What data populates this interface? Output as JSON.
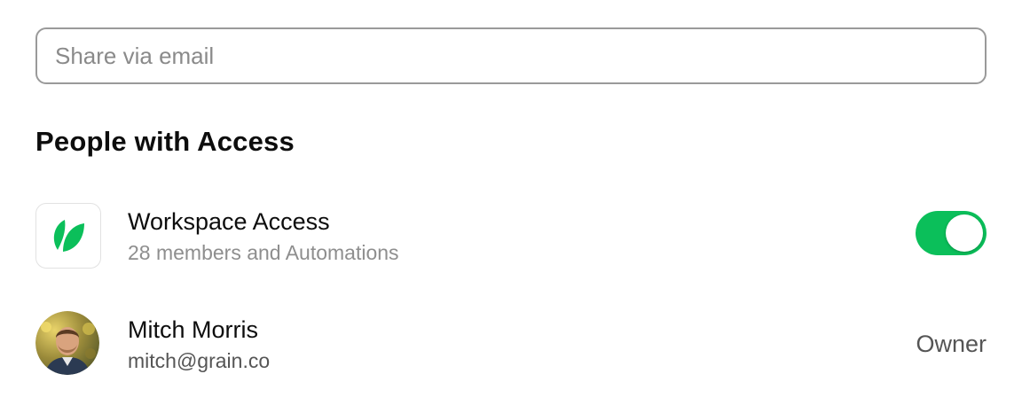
{
  "share": {
    "placeholder": "Share via email"
  },
  "section": {
    "title": "People with Access"
  },
  "workspace": {
    "title": "Workspace Access",
    "subtitle": "28 members and Automations",
    "logo_icon": "grain-leaf-icon",
    "access_enabled": true,
    "toggle_color": "#0bbf5a"
  },
  "members": [
    {
      "name": "Mitch Morris",
      "email": "mitch@grain.co",
      "role": "Owner",
      "avatar_icon": "user-avatar"
    }
  ],
  "colors": {
    "accent": "#0bbf5a",
    "border": "#9a9a9a",
    "muted_text": "#8e8e8e"
  }
}
